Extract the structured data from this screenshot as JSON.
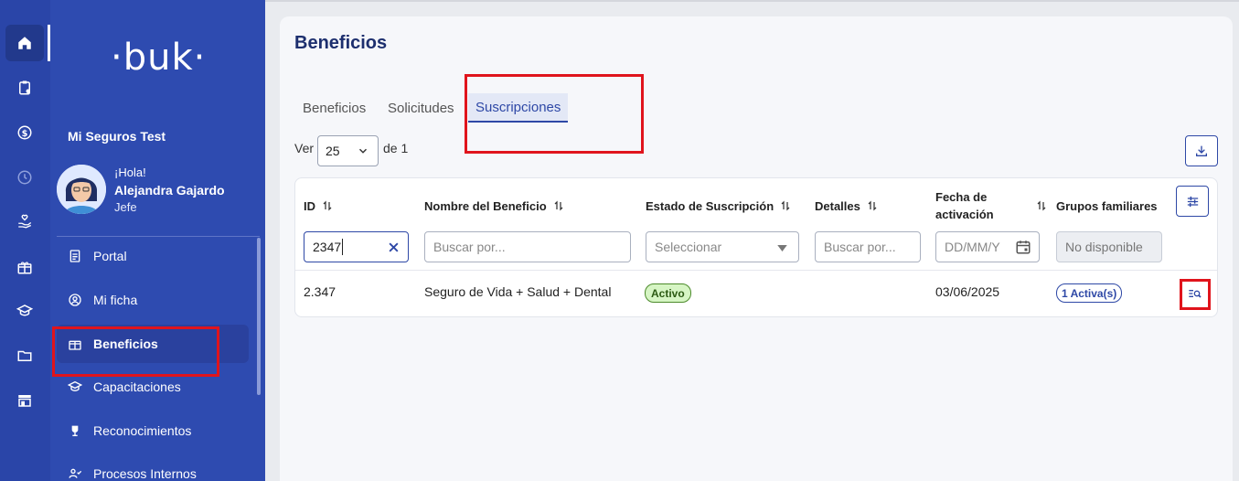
{
  "rail": {
    "icons": [
      "home-icon",
      "clipboard-icon",
      "dollar-icon",
      "clock-icon",
      "hand-heart-icon",
      "gift-icon",
      "graduation-icon",
      "folder-icon",
      "store-icon"
    ]
  },
  "sidebar": {
    "logo": "·buk·",
    "company": "Mi Seguros Test",
    "greeting": "¡Hola!",
    "user_name": "Alejandra Gajardo",
    "user_role": "Jefe",
    "items": [
      {
        "label": "Portal",
        "icon": "document-icon"
      },
      {
        "label": "Mi ficha",
        "icon": "user-circle-icon"
      },
      {
        "label": "Beneficios",
        "icon": "gift-icon"
      },
      {
        "label": "Capacitaciones",
        "icon": "graduation-icon"
      },
      {
        "label": "Reconocimientos",
        "icon": "trophy-icon"
      },
      {
        "label": "Procesos Internos",
        "icon": "people-icon"
      }
    ]
  },
  "page": {
    "title": "Beneficios",
    "tabs": [
      "Beneficios",
      "Solicitudes",
      "Suscripciones"
    ],
    "active_tab": "Suscripciones",
    "pager": {
      "ver": "Ver",
      "page_size": "25",
      "de": "de 1"
    }
  },
  "table": {
    "headers": [
      "ID",
      "Nombre del Beneficio",
      "Estado de Suscripción",
      "Detalles",
      "Fecha de activación",
      "Grupos familiares"
    ],
    "filters": {
      "id_value": "2347",
      "nombre_placeholder": "Buscar por...",
      "estado_placeholder": "Seleccionar",
      "detalles_placeholder": "Buscar por...",
      "fecha_placeholder": "DD/MM/Y",
      "grupos_placeholder": "No disponible"
    },
    "rows": [
      {
        "id": "2.347",
        "nombre": "Seguro de Vida + Salud + Dental",
        "estado": "Activo",
        "detalles": "",
        "fecha": "03/06/2025",
        "grupos": "1 Activa(s)"
      }
    ]
  },
  "colors": {
    "primary": "#2e48a6",
    "sidebar": "#2e4bb0",
    "highlight": "#e0141c",
    "success_bg": "#d6f5c4"
  }
}
